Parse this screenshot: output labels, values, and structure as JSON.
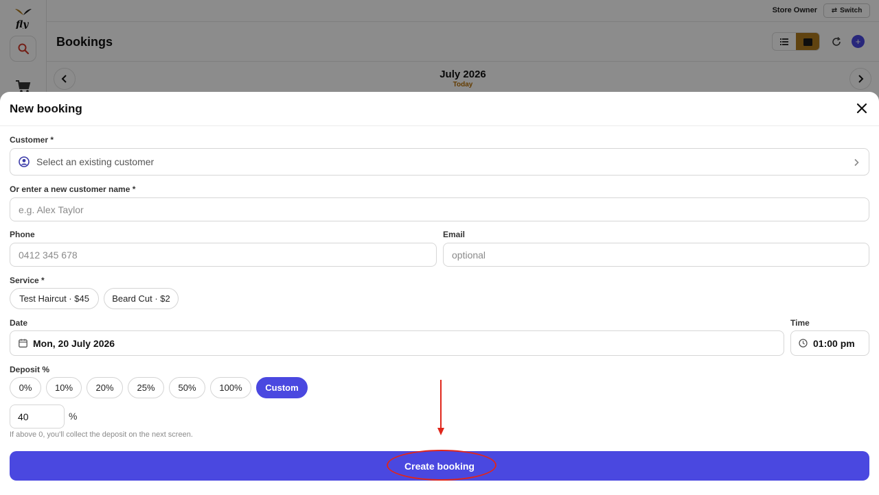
{
  "topbar": {
    "user_role": "Store Owner",
    "switch_label": "Switch"
  },
  "header": {
    "title": "Bookings"
  },
  "calendar": {
    "month": "July 2026",
    "today_label": "Today"
  },
  "modal": {
    "title": "New booking",
    "customer": {
      "label": "Customer *",
      "placeholder": "Select an existing customer"
    },
    "new_customer": {
      "label": "Or enter a new customer name *",
      "placeholder": "e.g. Alex Taylor"
    },
    "phone": {
      "label": "Phone",
      "placeholder": "0412 345 678"
    },
    "email": {
      "label": "Email",
      "placeholder": "optional"
    },
    "service": {
      "label": "Service *",
      "options": [
        "Test Haircut · $45",
        "Beard Cut · $2"
      ]
    },
    "date": {
      "label": "Date",
      "value": "Mon, 20 July 2026"
    },
    "time": {
      "label": "Time",
      "value": "01:00 pm"
    },
    "deposit": {
      "label": "Deposit %",
      "options": [
        "0%",
        "10%",
        "20%",
        "25%",
        "50%",
        "100%",
        "Custom"
      ],
      "selected": "Custom",
      "custom_value": "40",
      "unit": "%",
      "hint": "If above 0, you'll collect the deposit on the next screen."
    },
    "submit_label": "Create booking"
  },
  "colors": {
    "accent": "#4a48e0",
    "brand_gold": "#b07a1e",
    "annotation_red": "#e0261b"
  }
}
